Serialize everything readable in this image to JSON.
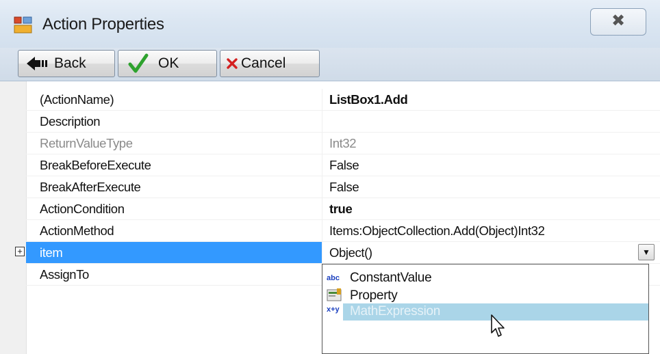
{
  "window": {
    "title": "Action Properties",
    "close_glyph": "✖"
  },
  "toolbar": {
    "back_label": "Back",
    "ok_label": "OK",
    "cancel_label": "Cancel"
  },
  "properties": [
    {
      "name": "(ActionName)",
      "value": "ListBox1.Add"
    },
    {
      "name": "Description",
      "value": ""
    },
    {
      "name": "ReturnValueType",
      "value": "Int32"
    },
    {
      "name": "BreakBeforeExecute",
      "value": "False"
    },
    {
      "name": "BreakAfterExecute",
      "value": "False"
    },
    {
      "name": "ActionCondition",
      "value": "true"
    },
    {
      "name": "ActionMethod",
      "value": "Items:ObjectCollection.Add(Object)Int32"
    },
    {
      "name": "item",
      "value": "Object()"
    },
    {
      "name": "AssignTo",
      "value": ""
    }
  ],
  "dropdown": {
    "items": [
      {
        "icon": "abc",
        "label": "ConstantValue"
      },
      {
        "icon": "property-icon",
        "label": "Property"
      },
      {
        "icon": "x+y",
        "label": "MathExpression"
      }
    ],
    "selected_index": 2
  },
  "colors": {
    "selection": "#3399ff",
    "dropdown_highlight": "#aad5e8",
    "titlebar": "#dbe6f2"
  }
}
